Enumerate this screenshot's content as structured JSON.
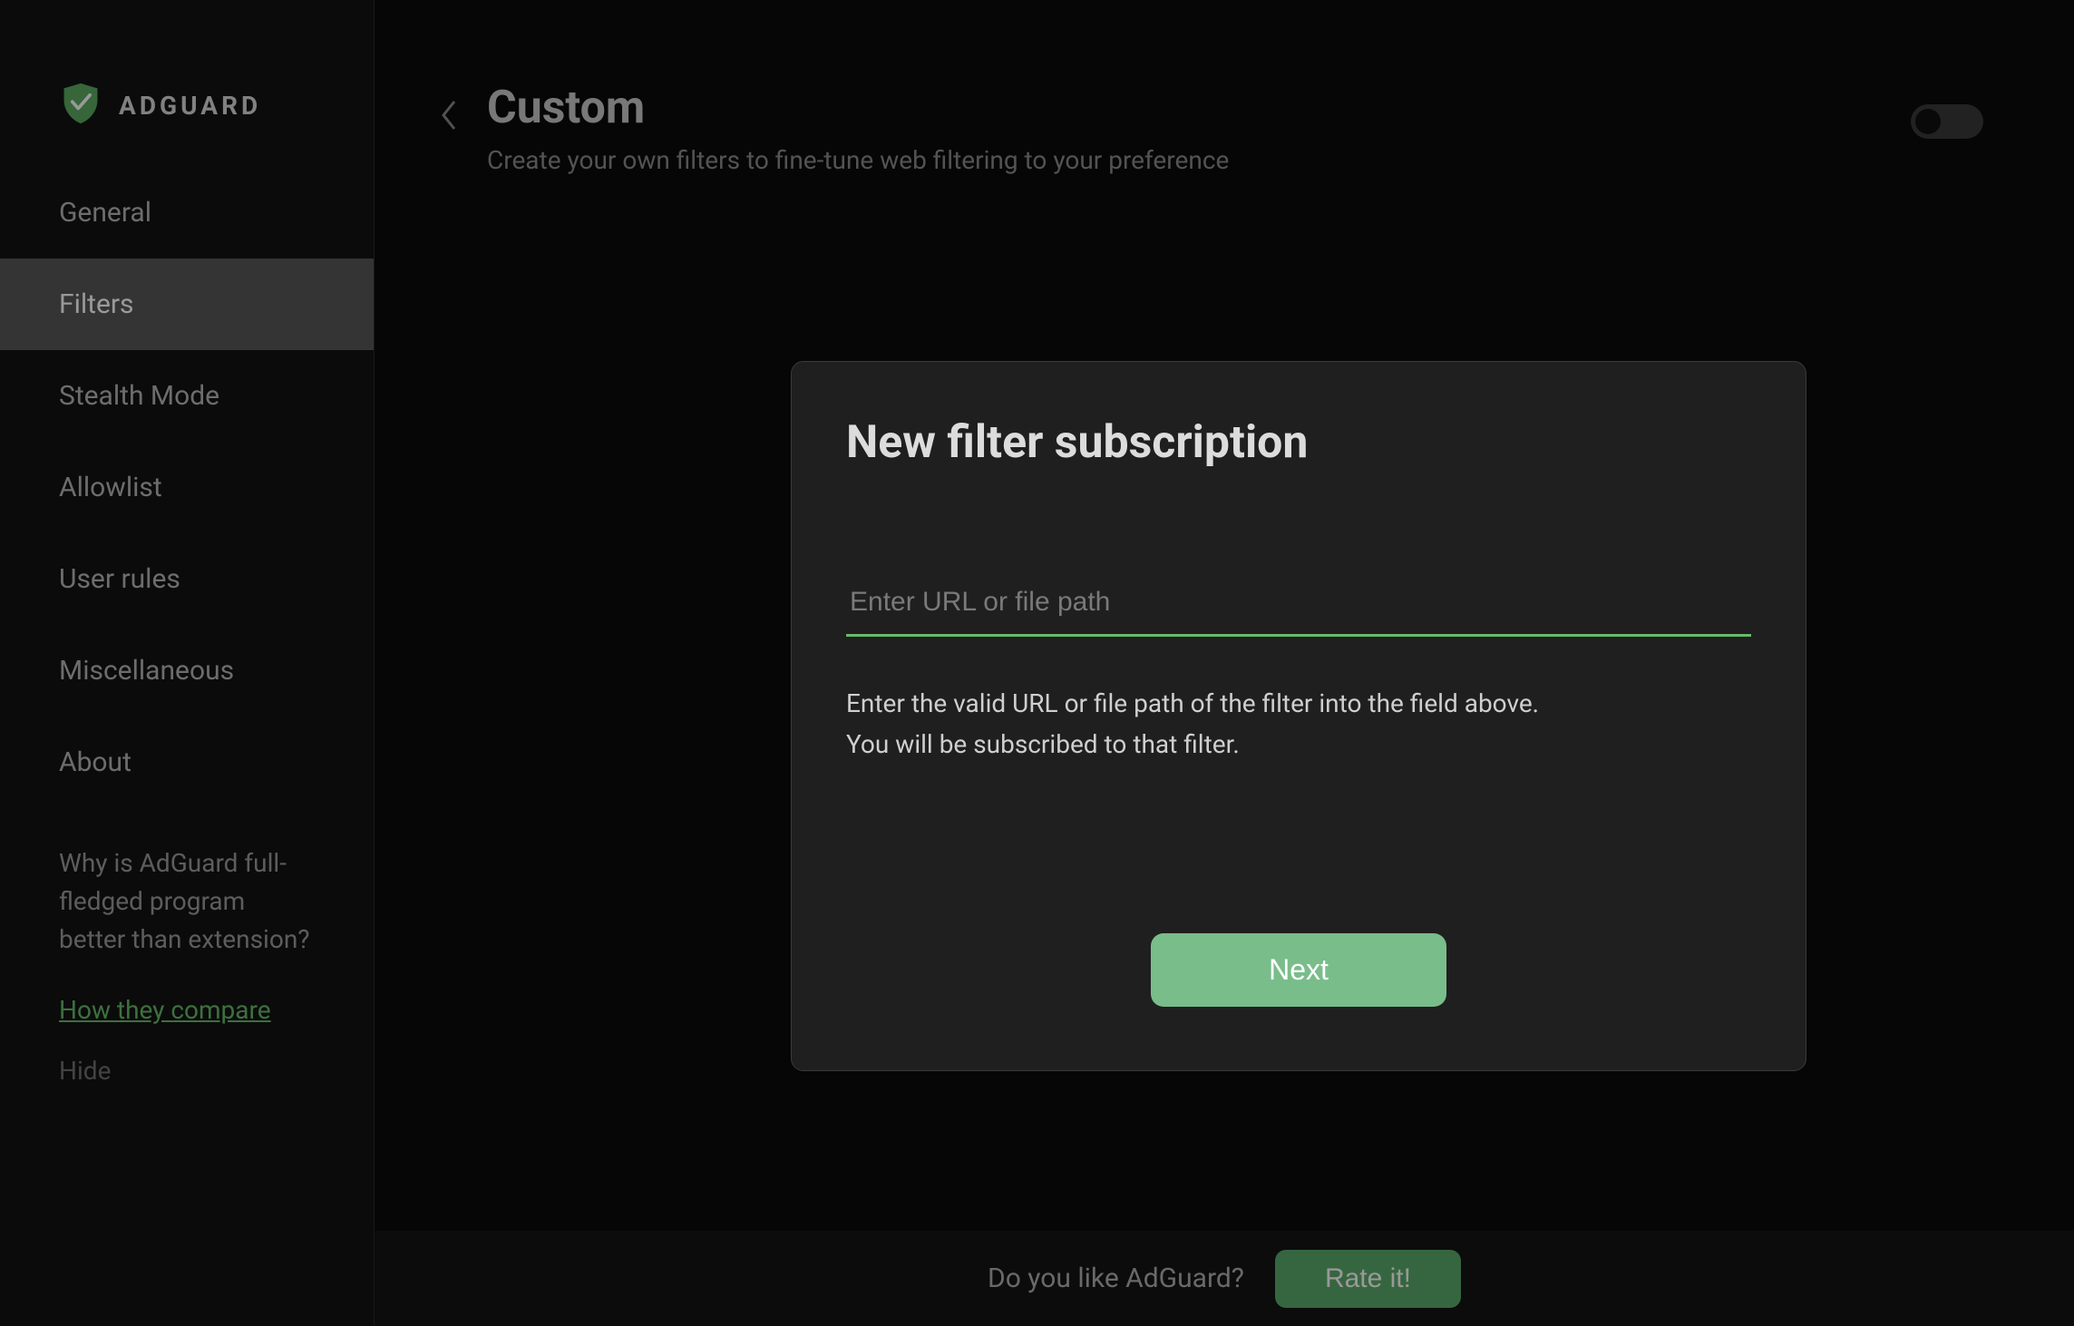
{
  "brand": "ADGUARD",
  "sidebar": {
    "items": [
      {
        "label": "General"
      },
      {
        "label": "Filters"
      },
      {
        "label": "Stealth Mode"
      },
      {
        "label": "Allowlist"
      },
      {
        "label": "User rules"
      },
      {
        "label": "Miscellaneous"
      },
      {
        "label": "About"
      }
    ],
    "promo": {
      "text": "Why is AdGuard full-fledged program better than extension?",
      "link": "How they compare",
      "hide": "Hide"
    }
  },
  "header": {
    "title": "Custom",
    "subtitle": "Create your own filters to fine-tune web filtering to your preference"
  },
  "footer": {
    "text": "Do you like AdGuard?",
    "button": "Rate it!"
  },
  "modal": {
    "title": "New filter subscription",
    "placeholder": "Enter URL or file path",
    "hint": "Enter the valid URL or file path of the filter into the field above.\nYou will be subscribed to that filter.",
    "next": "Next"
  },
  "colors": {
    "accent": "#66bb6a",
    "background": "#0a0a0a",
    "panel": "#1f1f1f"
  }
}
